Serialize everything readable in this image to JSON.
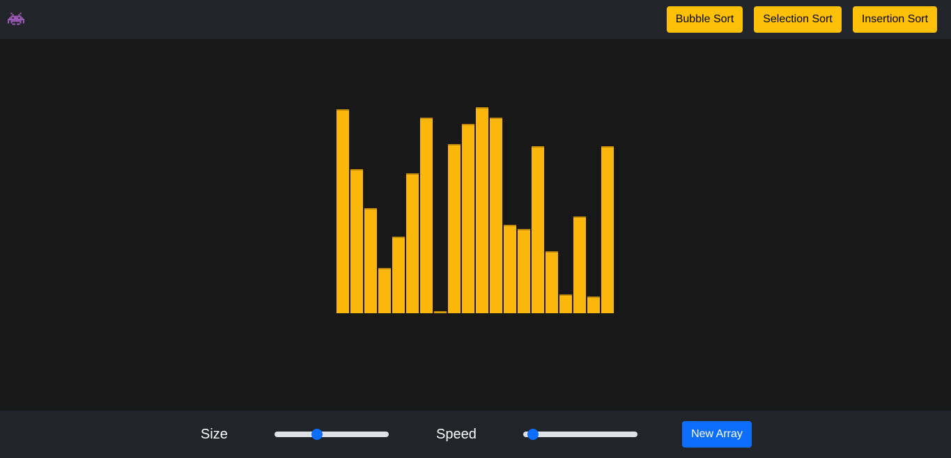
{
  "navbar": {
    "logo_icon": "space-invader-icon",
    "logo_color": "#9b59b6",
    "buttons": [
      {
        "label": "Bubble Sort"
      },
      {
        "label": "Selection Sort"
      },
      {
        "label": "Insertion Sort"
      }
    ],
    "button_color": "#ffc107"
  },
  "visualizer": {
    "bar_color": "#fbb70a",
    "background": "#181818",
    "max_value": 100,
    "values": [
      99,
      70,
      51,
      22,
      37,
      68,
      95,
      1,
      82,
      92,
      100,
      95,
      43,
      41,
      81,
      30,
      9,
      47,
      8,
      81
    ]
  },
  "controls": {
    "size_label": "Size",
    "size_value_fraction": 0.36,
    "speed_label": "Speed",
    "speed_value_fraction": 0.04,
    "new_array_label": "New Array",
    "accent_color": "#0d6efd"
  }
}
